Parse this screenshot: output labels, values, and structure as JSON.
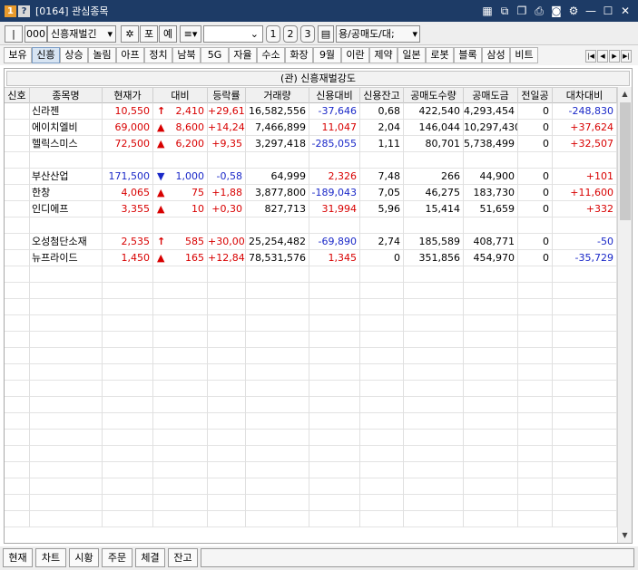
{
  "window": {
    "number_icon": "1",
    "help_icon": "?",
    "title": "[0164] 관심종목"
  },
  "toolbar": {
    "prev_label": "|◀◀",
    "group_code": "000",
    "group_name": "신흥재벌긴",
    "btn_po": "포",
    "btn_ye": "예",
    "view_mode": "≡",
    "page1": "1",
    "page2": "2",
    "page3": "3",
    "field_select": "용/공매도/대;"
  },
  "tabs": [
    "보유",
    "신흥",
    "상승",
    "놀림",
    "아프",
    "정치",
    "남북",
    "5G",
    "자율",
    "수소",
    "화장",
    "9월",
    "이란",
    "제약",
    "일본",
    "로봇",
    "블록",
    "삼성",
    "비트"
  ],
  "table": {
    "caption": "(관) 신흥재벌강도",
    "headers": [
      "신호",
      "종목명",
      "현재가",
      "대비",
      "등락률",
      "거래량",
      "신용대비",
      "신용잔고",
      "공매도수량",
      "공매도금",
      "전일공",
      "대차대비"
    ],
    "rows": [
      {
        "name": "신라젠",
        "price": "10,550",
        "sym": "↑",
        "diff": "2,410",
        "rate": "+29,61",
        "vol": "16,582,556",
        "credit": "-37,646",
        "credit_bal": "0,68",
        "short_qty": "422,540",
        "short_amt": "4,293,454",
        "prev": "0",
        "loan": "-248,830",
        "dir": "up",
        "flag": false
      },
      {
        "name": "에이치엘비",
        "price": "69,000",
        "sym": "▲",
        "diff": "8,600",
        "rate": "+14,24",
        "vol": "7,466,899",
        "credit": "11,047",
        "credit_bal": "2,04",
        "short_qty": "146,044",
        "short_amt": "10,297,430",
        "prev": "0",
        "loan": "+37,624",
        "dir": "up",
        "flag": false
      },
      {
        "name": "헬릭스미스",
        "price": "72,500",
        "sym": "▲",
        "diff": "6,200",
        "rate": "+9,35",
        "vol": "3,297,418",
        "credit": "-285,055",
        "credit_bal": "1,11",
        "short_qty": "80,701",
        "short_amt": "5,738,499",
        "prev": "0",
        "loan": "+32,507",
        "dir": "up",
        "flag": false
      },
      {
        "name": "",
        "price": "",
        "sym": "",
        "diff": "",
        "rate": "",
        "vol": "",
        "credit": "",
        "credit_bal": "",
        "short_qty": "",
        "short_amt": "",
        "prev": "",
        "loan": "",
        "dir": "",
        "flag": false
      },
      {
        "name": "부산산업",
        "price": "171,500",
        "sym": "▼",
        "diff": "1,000",
        "rate": "-0,58",
        "vol": "64,999",
        "credit": "2,326",
        "credit_bal": "7,48",
        "short_qty": "266",
        "short_amt": "44,900",
        "prev": "0",
        "loan": "+101",
        "dir": "down",
        "flag": true
      },
      {
        "name": "한창",
        "price": "4,065",
        "sym": "▲",
        "diff": "75",
        "rate": "+1,88",
        "vol": "3,877,800",
        "credit": "-189,043",
        "credit_bal": "7,05",
        "short_qty": "46,275",
        "short_amt": "183,730",
        "prev": "0",
        "loan": "+11,600",
        "dir": "up",
        "flag": true
      },
      {
        "name": "인디에프",
        "price": "3,355",
        "sym": "▲",
        "diff": "10",
        "rate": "+0,30",
        "vol": "827,713",
        "credit": "31,994",
        "credit_bal": "5,96",
        "short_qty": "15,414",
        "short_amt": "51,659",
        "prev": "0",
        "loan": "+332",
        "dir": "up",
        "flag": true
      },
      {
        "name": "",
        "price": "",
        "sym": "",
        "diff": "",
        "rate": "",
        "vol": "",
        "credit": "",
        "credit_bal": "",
        "short_qty": "",
        "short_amt": "",
        "prev": "",
        "loan": "",
        "dir": "",
        "flag": false
      },
      {
        "name": "오성첨단소재",
        "price": "2,535",
        "sym": "↑",
        "diff": "585",
        "rate": "+30,00",
        "vol": "25,254,482",
        "credit": "-69,890",
        "credit_bal": "2,74",
        "short_qty": "185,589",
        "short_amt": "408,771",
        "prev": "0",
        "loan": "-50",
        "dir": "up",
        "flag": true
      },
      {
        "name": "뉴프라이드",
        "price": "1,450",
        "sym": "▲",
        "diff": "165",
        "rate": "+12,84",
        "vol": "78,531,576",
        "credit": "1,345",
        "credit_bal": "0",
        "short_qty": "351,856",
        "short_amt": "454,970",
        "prev": "0",
        "loan": "-35,729",
        "dir": "up",
        "flag": true
      }
    ]
  },
  "bottom_buttons": [
    "현재",
    "차트",
    "시황",
    "주문",
    "체결",
    "잔고"
  ],
  "colors": {
    "up": "#d80000",
    "down": "#1a28c8",
    "title_bg": "#1d3b66"
  }
}
